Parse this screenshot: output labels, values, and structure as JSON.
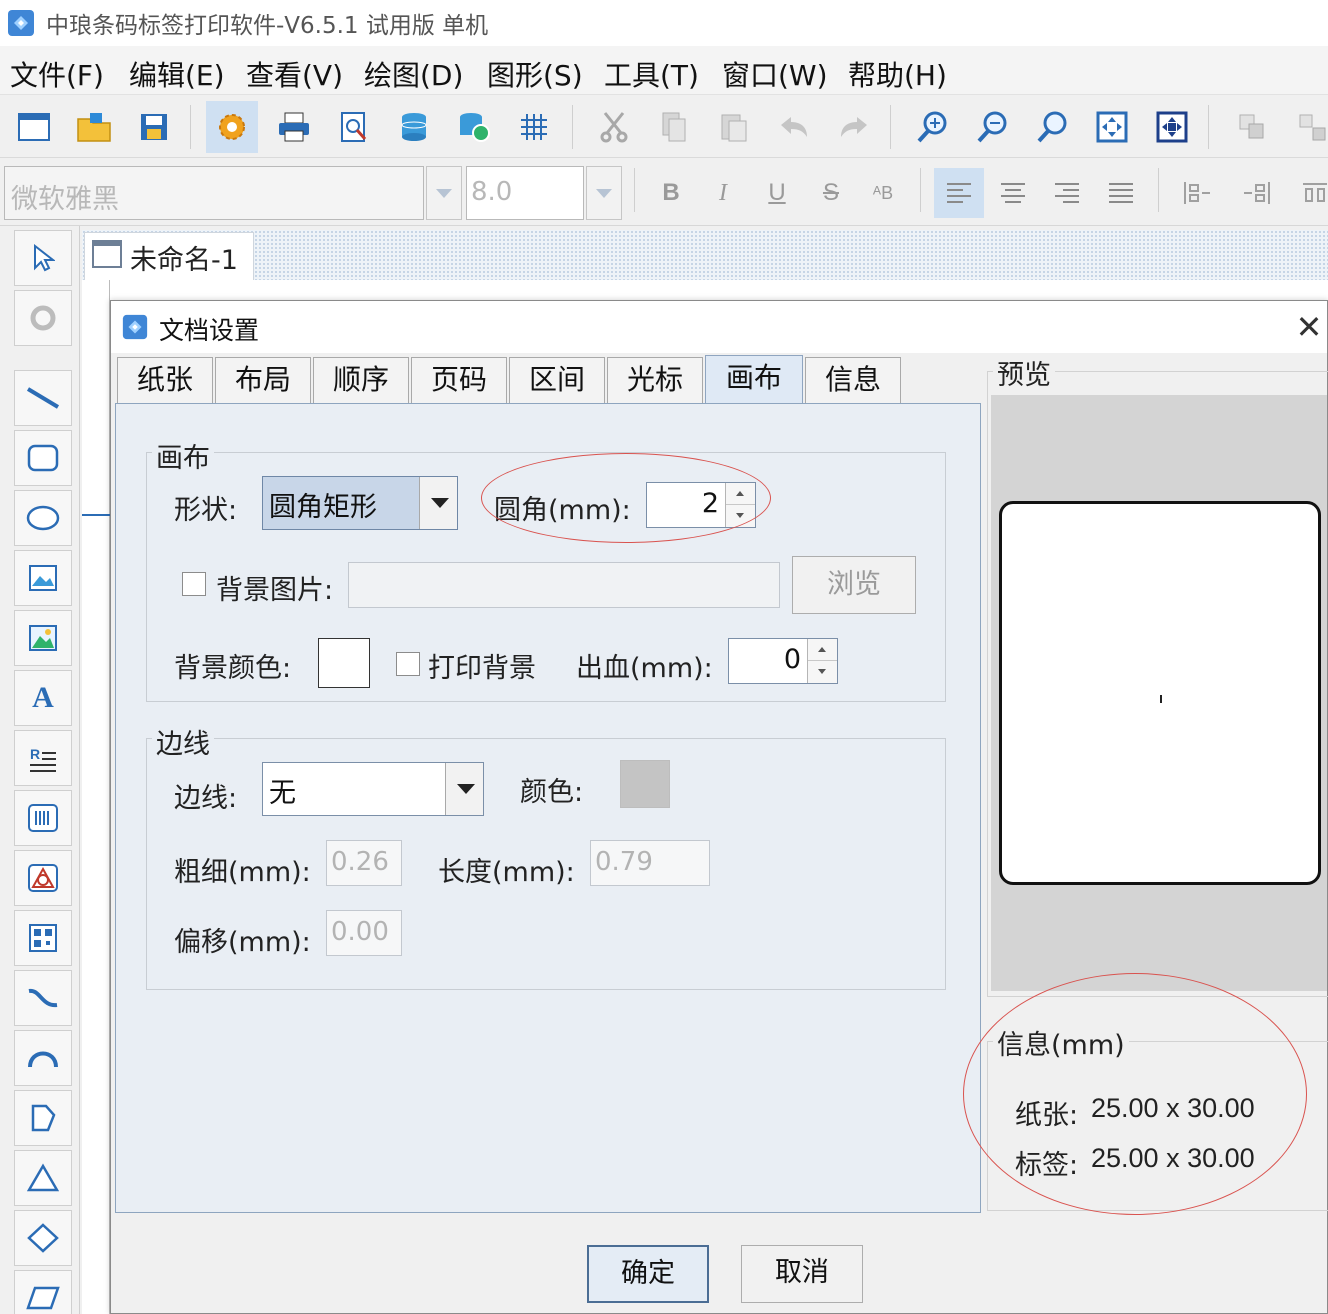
{
  "app": {
    "title": "中琅条码标签打印软件-V6.5.1 试用版 单机"
  },
  "menu": {
    "items": [
      "文件(F)",
      "编辑(E)",
      "查看(V)",
      "绘图(D)",
      "图形(S)",
      "工具(T)",
      "窗口(W)",
      "帮助(H)"
    ]
  },
  "format_bar": {
    "font_name": "微软雅黑",
    "font_size": "8.0",
    "bold": "B",
    "italic": "I",
    "underline": "U",
    "strike": "S",
    "special": "ᴬB"
  },
  "document": {
    "tab_title": "未命名-1"
  },
  "dialog": {
    "title": "文档设置",
    "close_glyph": "✕",
    "tabs": [
      "纸张",
      "布局",
      "顺序",
      "页码",
      "区间",
      "光标",
      "画布",
      "信息"
    ],
    "active_tab": "画布",
    "canvas_group": {
      "title": "画布",
      "shape_label": "形状:",
      "shape_value": "圆角矩形",
      "radius_label": "圆角(mm):",
      "radius_value": "2",
      "bg_image_label": "背景图片:",
      "bg_image_value": "",
      "browse_label": "浏览",
      "bg_color_label": "背景颜色:",
      "bg_color": "#ffffff",
      "print_bg_label": "打印背景",
      "bleed_label": "出血(mm):",
      "bleed_value": "0"
    },
    "border_group": {
      "title": "边线",
      "border_label": "边线:",
      "border_value": "无",
      "color_label": "颜色:",
      "color": "#c4c4c4",
      "thickness_label": "粗细(mm):",
      "thickness_value": "0.26",
      "length_label": "长度(mm):",
      "length_value": "0.79",
      "offset_label": "偏移(mm):",
      "offset_value": "0.00"
    },
    "preview": {
      "title": "预览"
    },
    "info": {
      "title": "信息(mm)",
      "paper_label": "纸张:",
      "paper_value": "25.00 x 30.00",
      "label_label": "标签:",
      "label_value": "25.00 x 30.00"
    },
    "ok_label": "确定",
    "cancel_label": "取消"
  },
  "colors": {
    "accent_ellipse": "#d9534f",
    "active_tab": "#dfe9f5"
  }
}
